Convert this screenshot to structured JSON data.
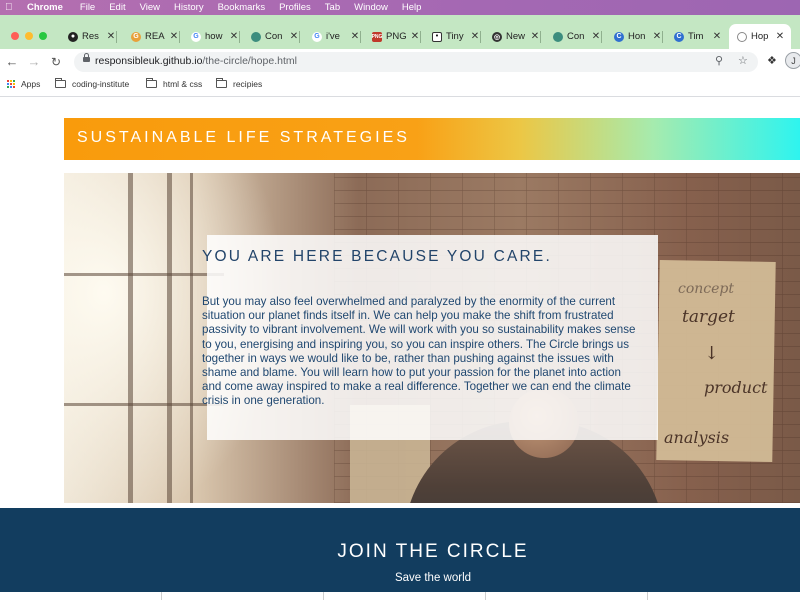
{
  "menubar": {
    "app": "Chrome",
    "items": [
      "File",
      "Edit",
      "View",
      "History",
      "Bookmarks",
      "Profiles",
      "Tab",
      "Window",
      "Help"
    ]
  },
  "tabs": [
    {
      "title": "Res",
      "icon": "github-icon"
    },
    {
      "title": "REA",
      "icon": "grammarly-icon"
    },
    {
      "title": "how",
      "icon": "google-icon"
    },
    {
      "title": "Con",
      "icon": "leaf-icon"
    },
    {
      "title": "i've",
      "icon": "google-icon"
    },
    {
      "title": "PNG",
      "icon": "png-icon"
    },
    {
      "title": "Tiny",
      "icon": "panda-icon"
    },
    {
      "title": "New",
      "icon": "new-tab-icon"
    },
    {
      "title": "Con",
      "icon": "leaf-icon"
    },
    {
      "title": "Hon",
      "icon": "edge-icon"
    },
    {
      "title": "Tim",
      "icon": "edge-icon"
    },
    {
      "title": "Hop",
      "icon": "globe-icon",
      "active": true
    }
  ],
  "address": {
    "host": "responsibleuk.github.io",
    "path": "/the-circle/hope.html"
  },
  "profile": {
    "initial": "J"
  },
  "bookmarks": {
    "apps": "Apps",
    "folders": [
      "coding-institute",
      "html & css",
      "recipies"
    ]
  },
  "page": {
    "banner_title": "SUSTAINABLE LIFE STRATEGIES",
    "hero_heading": "YOU ARE HERE BECAUSE YOU CARE.",
    "hero_body": "But you may also feel overwhelmed and paralyzed by the enormity of the current situation our planet finds itself in. We can help you make the shift from frustrated passivity to vibrant involvement. We will work with you so sustainability makes sense to you, energising and inspiring you, so you can inspire others. The Circle brings us together in ways we would like to be, rather than pushing against the issues with shame and blame. You will learn how to put your passion for the planet into action and come away inspired to make a real difference. Together we can end the climate crisis in one generation.",
    "photo_scribbles": [
      "concept",
      "target",
      "product",
      "analysis"
    ],
    "join_title": "JOIN THE CIRCLE",
    "join_subtitle": "Save the world"
  },
  "colors": {
    "menubar": "#a86bb2",
    "tabstrip": "#c4e7c3",
    "banner_start": "#f99b0c",
    "banner_end": "#2ef4ef",
    "heading": "#22446a",
    "join_bg": "#123d5f"
  }
}
